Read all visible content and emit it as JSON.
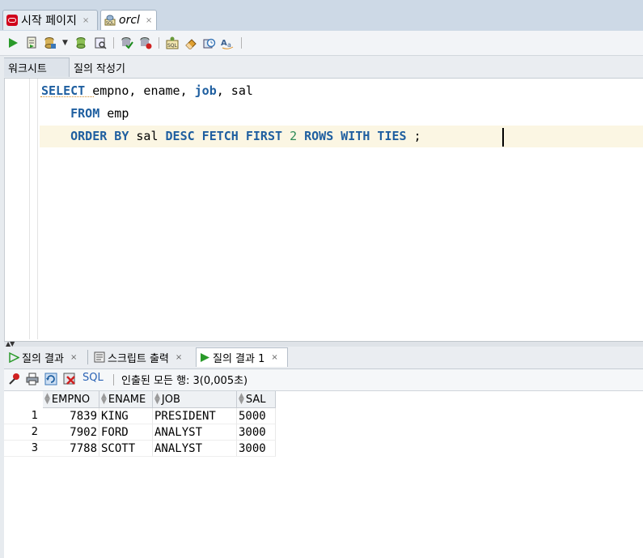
{
  "doc_tabs": [
    {
      "label": "시작 페이지",
      "close": "×",
      "icon": "oracle-logo-icon"
    },
    {
      "label": "orcl",
      "close": "×",
      "icon": "sql-worksheet-icon"
    }
  ],
  "sub_tabs": [
    {
      "label": "워크시트"
    },
    {
      "label": "질의 작성기"
    }
  ],
  "editor": {
    "lines": [
      {
        "indent": "",
        "tokens": [
          {
            "t": "SELECT",
            "c": "sel"
          },
          {
            "t": " empno, ename, ",
            "c": ""
          },
          {
            "t": "job",
            "c": "kw"
          },
          {
            "t": ", sal",
            "c": ""
          }
        ]
      },
      {
        "indent": "    ",
        "tokens": [
          {
            "t": "FROM",
            "c": "kw"
          },
          {
            "t": " emp",
            "c": ""
          }
        ]
      },
      {
        "indent": "    ",
        "tokens": [
          {
            "t": "ORDER BY",
            "c": "kw"
          },
          {
            "t": " sal ",
            "c": ""
          },
          {
            "t": "DESC FETCH FIRST",
            "c": "kw"
          },
          {
            "t": " ",
            "c": ""
          },
          {
            "t": "2",
            "c": "num"
          },
          {
            "t": " ",
            "c": ""
          },
          {
            "t": "ROWS WITH TIES",
            "c": "kw"
          },
          {
            "t": " ;",
            "c": ""
          }
        ]
      }
    ]
  },
  "result_tabs": [
    {
      "label": "질의 결과",
      "close": "×",
      "icon": "play-icon"
    },
    {
      "label": "스크립트 출력",
      "close": "×",
      "icon": "script-output-icon"
    },
    {
      "label": "질의 결과 1",
      "close": "×",
      "icon": "play-icon"
    }
  ],
  "result_toolbar": {
    "sql_label": "SQL",
    "status": "인출된 모든 행: 3(0,005초)"
  },
  "grid": {
    "columns": [
      "EMPNO",
      "ENAME",
      "JOB",
      "SAL"
    ],
    "rows": [
      {
        "n": "1",
        "cells": [
          "7839",
          "KING",
          "PRESIDENT",
          "5000"
        ]
      },
      {
        "n": "2",
        "cells": [
          "7902",
          "FORD",
          "ANALYST",
          "3000"
        ]
      },
      {
        "n": "3",
        "cells": [
          "7788",
          "SCOTT",
          "ANALYST",
          "3000"
        ]
      }
    ]
  },
  "colors": {
    "keyword": "#1f5fa0",
    "number": "#2e8b57",
    "current_line": "#fbf6e3",
    "tab_bar": "#cdd9e6"
  }
}
